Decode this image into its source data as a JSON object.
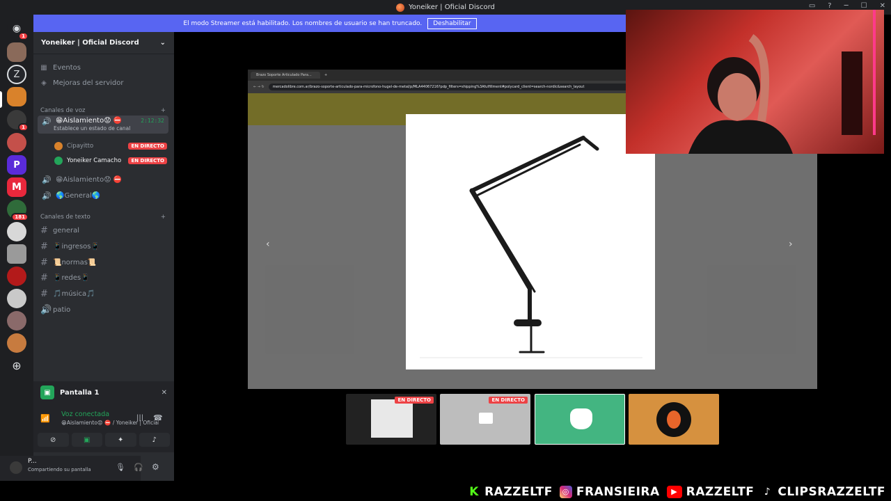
{
  "window": {
    "title": "Yoneiker | Oficial Discord"
  },
  "banner": {
    "message": "El modo Streamer está habilitado. Los nombres de usuario se han truncado.",
    "button": "Deshabilitar"
  },
  "guilds": {
    "home_badge": "1",
    "badge2": "1",
    "badge3": "181"
  },
  "server": {
    "name": "Yoneiker | Oficial Discord",
    "events": "Eventos",
    "boost": "Mejoras del servidor",
    "voice_category": "Canales de voz",
    "text_category": "Canales de texto",
    "active_channel": {
      "name": "😁Aislamiento😟 ⛔",
      "status": "Establece un estado de canal",
      "timer": "2:12:32"
    },
    "members": [
      {
        "name": "Cipayitto",
        "badge": "EN DIRECTO"
      },
      {
        "name": "Yoneiker Camacho",
        "badge": "EN DIRECTO"
      }
    ],
    "voice_channels": [
      "😁Aislamiento😟 ⛔",
      "🌎General🌎"
    ],
    "text_channels": [
      "general",
      "📱ingresos📱",
      "📜normas📜",
      "📱redes📱",
      "🎵música🎵",
      "patio"
    ]
  },
  "screen_panel": {
    "title": "Pantalla 1"
  },
  "voice": {
    "status": "Voz conectada",
    "detail": "😁Aislamiento😟 ⛔ / Yoneiker | Oficial..."
  },
  "user": {
    "name": "P...",
    "status": "Compartiendo su pantalla"
  },
  "browser": {
    "tab_title": "Brazo Soporte Articulado Para...",
    "url": "mercadolibre.com.ar/brazo-soporte-articulado-para-microfono-hugel-de-metal/p/MLA44067216?pdp_filters=shipping%3Afulfillment#polycard_client=search-nordic&search_layout"
  },
  "thumbs": [
    {
      "badge": "EN DIRECTO"
    },
    {
      "badge": "EN DIRECTO"
    }
  ],
  "socials": [
    {
      "platform": "kick-icon",
      "handle": "RAZZELTF",
      "color": "#53fc18"
    },
    {
      "platform": "instagram-icon",
      "handle": "FRANSIEIRA",
      "color": "#d62976"
    },
    {
      "platform": "youtube-icon",
      "handle": "RAZZELTF",
      "color": "#ff0000"
    },
    {
      "platform": "tiktok-icon",
      "handle": "CLIPSRAZZELTF",
      "color": "#ffffff"
    }
  ],
  "colors": {
    "blurple": "#5865f2",
    "live": "#ed4245",
    "green": "#23a55a"
  }
}
